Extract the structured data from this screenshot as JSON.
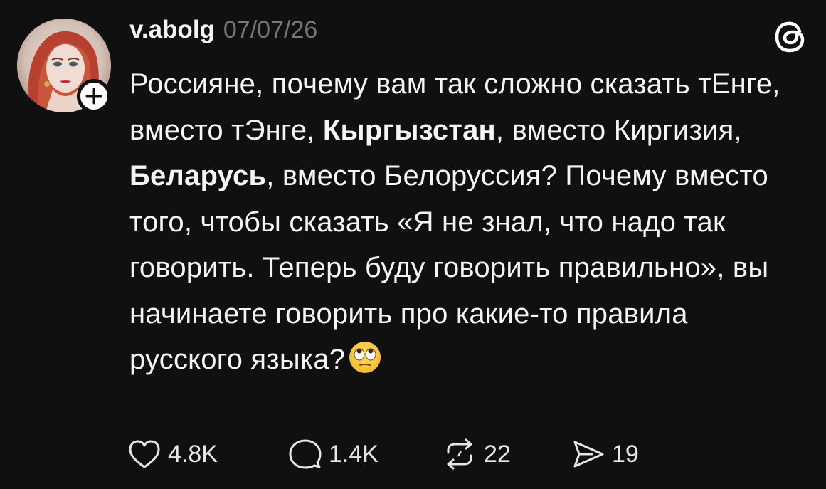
{
  "post": {
    "username": "v.abolg",
    "timestamp": "07/07/26",
    "text": {
      "p1": "Россияне, почему вам так сложно сказать тЕнге, вместо тЭнге, ",
      "bold1": "Кыргызстан",
      "p2": ", вместо Киргизия, ",
      "bold2": "Беларусь",
      "p3": ", вместо Белоруссия? Почему вместо того, чтобы сказать «Я не знал, что надо так говорить. Теперь буду говорить правильно», вы начинаете говорить про какие-то правила русского языка?"
    },
    "emoji": "face-with-rolling-eyes"
  },
  "actions": {
    "likes": "4.8K",
    "replies": "1.4K",
    "reposts": "22",
    "shares": "19"
  },
  "icons": {
    "follow": "plus-icon",
    "brand": "threads-logo-icon",
    "like": "heart-icon",
    "reply": "comment-icon",
    "repost": "repost-icon",
    "share": "send-icon"
  },
  "colors": {
    "background": "#101010",
    "text": "#f3f5f7",
    "muted": "#777777"
  }
}
